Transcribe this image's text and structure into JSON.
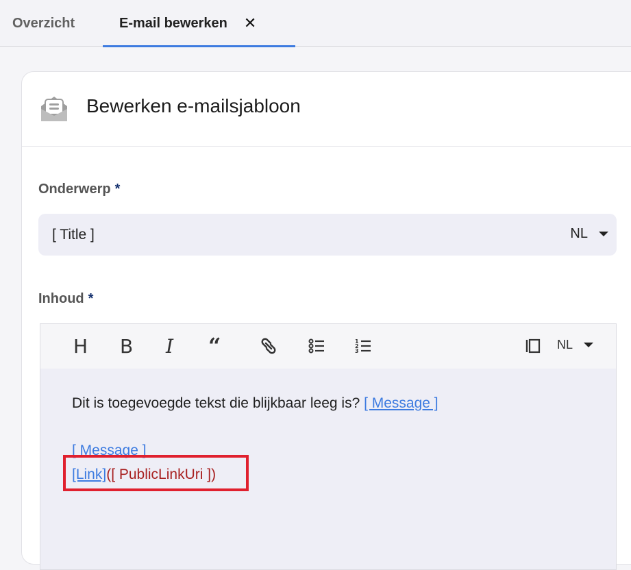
{
  "tabs": {
    "overview_label": "Overzicht",
    "edit_label": "E-mail bewerken",
    "close_symbol": "✕"
  },
  "card": {
    "title": "Bewerken e-mailsjabloon",
    "icon": "email-template-icon"
  },
  "form": {
    "subject_label": "Onderwerp",
    "required_mark": "*",
    "subject_value": "[ Title ]",
    "subject_lang": "NL",
    "content_label": "Inhoud"
  },
  "editor": {
    "toolbar": {
      "heading": "H",
      "bold": "B",
      "italic": "I",
      "quote": "“",
      "lang": "NL"
    },
    "body": {
      "line1_text": "Dit is toegevoegde tekst die blijkbaar leeg is? ",
      "line1_tag": "[ Message ]",
      "line2_tag": "[ Message ]",
      "link_text": "[Link]",
      "link_target": "([ PublicLinkUri ])"
    }
  },
  "colors": {
    "accent": "#3d7be0",
    "required": "#14306e",
    "highlight": "#e0202e"
  }
}
